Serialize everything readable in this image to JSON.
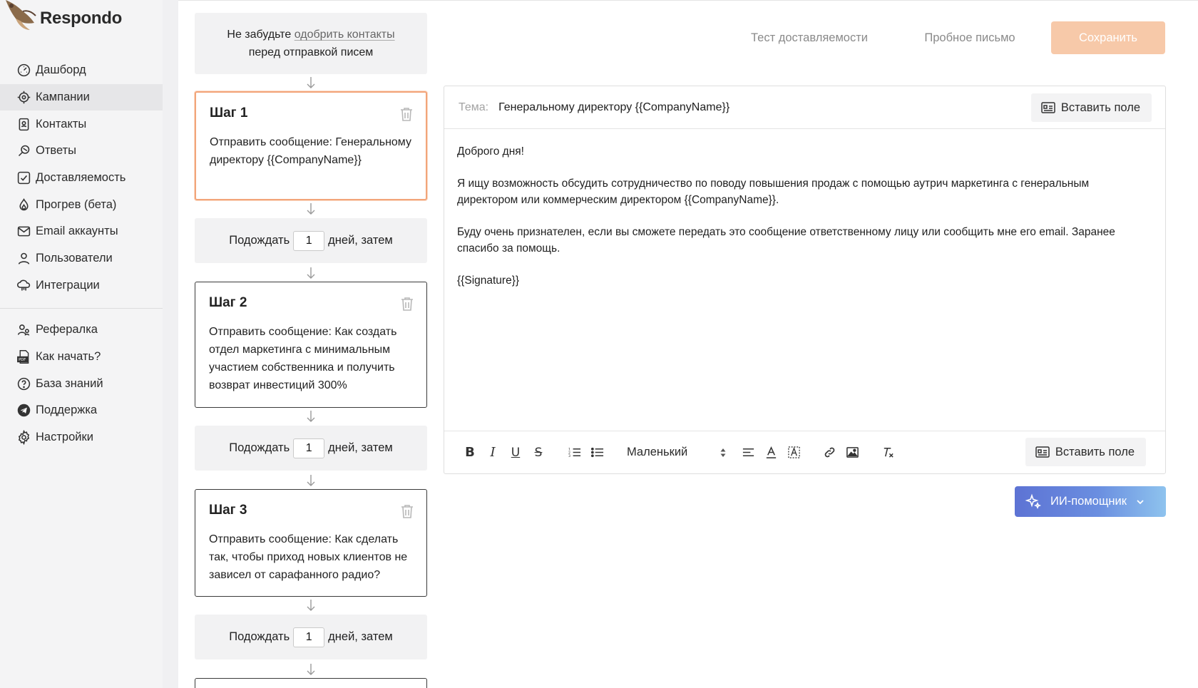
{
  "app": {
    "name": "Respondo"
  },
  "sidebar": {
    "main_items": [
      {
        "label": "Дашборд",
        "icon": "dashboard-gauge-icon"
      },
      {
        "label": "Кампании",
        "icon": "target-icon",
        "active": true
      },
      {
        "label": "Контакты",
        "icon": "contact-book-icon"
      },
      {
        "label": "Ответы",
        "icon": "replies-icon"
      },
      {
        "label": "Доставляемость",
        "icon": "checkbox-icon"
      },
      {
        "label": "Прогрев (бета)",
        "icon": "flame-icon"
      },
      {
        "label": "Email аккаунты",
        "icon": "mail-icon"
      },
      {
        "label": "Пользователи",
        "icon": "user-icon"
      },
      {
        "label": "Интеграции",
        "icon": "cloud-icon"
      }
    ],
    "secondary_items": [
      {
        "label": "Рефералка",
        "icon": "referral-users-icon"
      },
      {
        "label": "Как начать?",
        "icon": "pdf-icon"
      },
      {
        "label": "База знаний",
        "icon": "question-circle-icon"
      },
      {
        "label": "Поддержка",
        "icon": "telegram-icon"
      },
      {
        "label": "Настройки",
        "icon": "gear-icon"
      }
    ]
  },
  "steps_panel": {
    "note_prefix": "Не забудьте ",
    "note_link": "одобрить контакты",
    "note_suffix": "перед отправкой писем",
    "steps": [
      {
        "title": "Шаг 1",
        "body": "Отправить сообщение: Генеральному директору {{CompanyName}}",
        "selected": true
      },
      {
        "title": "Шаг 2",
        "body": "Отправить сообщение: Как создать отдел маркетинга с минимальным участием собственника и получить возврат инвестиций 300%"
      },
      {
        "title": "Шаг 3",
        "body": "Отправить сообщение: Как сделать так, чтобы приход новых клиентов не зависел от сарафанного радио?"
      }
    ],
    "wait": {
      "prefix": "Подождать",
      "value": "1",
      "suffix": "дней, затем"
    }
  },
  "topbar": {
    "deliverability_test": "Тест доставляемости",
    "test_email": "Пробное письмо",
    "save": "Сохранить"
  },
  "editor": {
    "subject_label": "Тема:",
    "subject_value": "Генеральному директору {{CompanyName}}",
    "insert_field": "Вставить поле",
    "body": [
      "Доброго дня!",
      "Я ищу возможность обсудить сотрудничество по поводу повышения продаж с помощью аутрич маркетинга с генеральным директором или коммерческим директором {{CompanyName}}.",
      "Буду очень признателен, если вы сможете передать это сообщение ответственному лицу или сообщить мне его email. Заранее спасибо за помощь.",
      "{{Signature}}"
    ],
    "toolbar": {
      "bold": "B",
      "italic": "I",
      "underline": "U",
      "strike": "S",
      "font_size": "Маленький"
    }
  },
  "ai_helper": {
    "label": "ИИ-помощник"
  },
  "colors": {
    "accent_orange": "#f2a57a",
    "save_button": "#f7c9a9",
    "ai_gradient_start": "#5d73d4",
    "ai_gradient_end": "#8ec3ee"
  }
}
